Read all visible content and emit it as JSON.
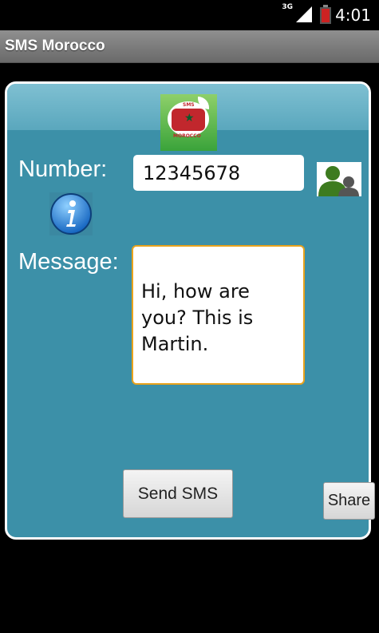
{
  "status_bar": {
    "network": "3G",
    "time": "4:01"
  },
  "app": {
    "title": "SMS Morocco"
  },
  "logo": {
    "text_top": "SMS",
    "text_bottom": "MOROCCO",
    "flag_color": "#c1272d",
    "star_color": "#0a5a2a"
  },
  "form": {
    "number_label": "Number:",
    "number_value": "12345678",
    "message_label": "Message:",
    "message_value": "Hi, how are you? This is Martin."
  },
  "buttons": {
    "send_label": "Send SMS",
    "share_label": "Share"
  },
  "icons": {
    "contact": "contact-icon",
    "info": "info-icon"
  },
  "colors": {
    "panel": "#3c90a8",
    "message_border": "#e8a21c",
    "title_bar": "#7a7a7a"
  }
}
